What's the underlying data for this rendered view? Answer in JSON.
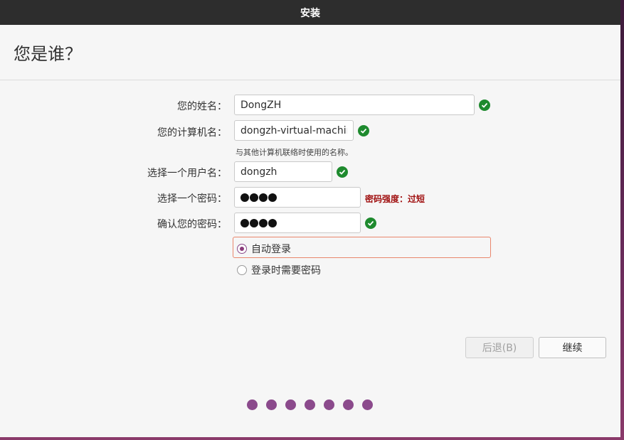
{
  "window": {
    "title": "安装"
  },
  "page": {
    "title": "您是谁？"
  },
  "form": {
    "name_label": "您的姓名：",
    "name_value": "DongZH",
    "computer_label": "您的计算机名：",
    "computer_value": "dongzh-virtual-machine",
    "computer_hint": "与其他计算机联络时使用的名称。",
    "username_label": "选择一个用户名：",
    "username_value": "dongzh",
    "password_label": "选择一个密码：",
    "password_length": 4,
    "password_strength": "密码强度：过短",
    "confirm_label": "确认您的密码：",
    "confirm_length": 4
  },
  "login": {
    "auto_label": "自动登录",
    "require_label": "登录时需要密码",
    "selected": "auto"
  },
  "buttons": {
    "back_label": "后退(B)",
    "continue_label": "继续"
  },
  "progress": {
    "steps": 7
  },
  "colors": {
    "success": "#1e8a2e",
    "warning": "#a01010",
    "accent": "#8b4a8c",
    "focus": "#e9866c"
  }
}
